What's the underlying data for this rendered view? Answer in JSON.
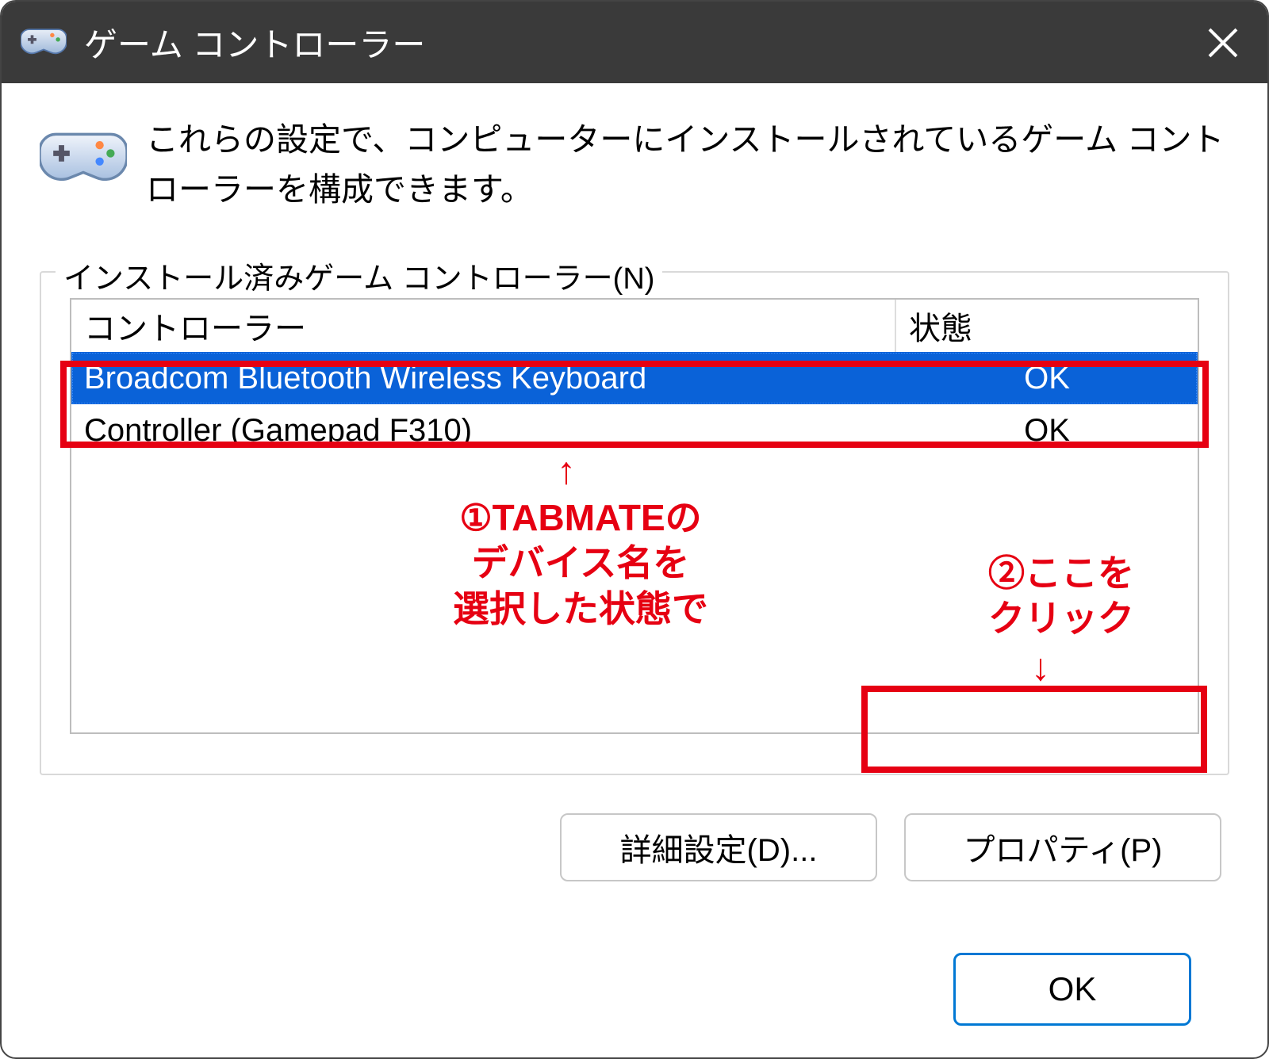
{
  "window": {
    "title": "ゲーム コントローラー"
  },
  "description": "これらの設定で、コンピューターにインストールされているゲーム コントローラーを構成できます。",
  "group": {
    "legend": "インストール済みゲーム コントローラー(N)",
    "columns": {
      "name": "コントローラー",
      "status": "状態"
    },
    "rows": [
      {
        "name": "Broadcom Bluetooth Wireless  Keyboard",
        "status": "OK",
        "selected": true
      },
      {
        "name": "Controller (Gamepad F310)",
        "status": "OK",
        "selected": false
      }
    ]
  },
  "buttons": {
    "advanced": "詳細設定(D)...",
    "properties": "プロパティ(P)",
    "ok": "OK"
  },
  "annotations": {
    "arrow_up": "↑",
    "arrow_down": "↓",
    "note1": "①TABMATEの\nデバイス名を\n選択した状態で",
    "note2": "②ここを\nクリック"
  }
}
